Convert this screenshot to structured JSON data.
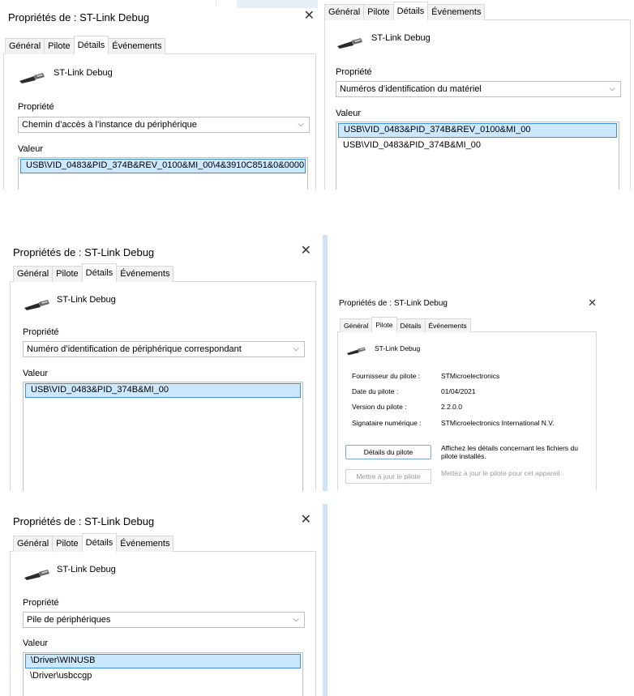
{
  "title": "Propriétés de : ST-Link Debug",
  "close_glyph": "✕",
  "chevron_glyph": "⌵",
  "tabs": [
    "Général",
    "Pilote",
    "Détails",
    "Événements"
  ],
  "device_name": "ST-Link Debug",
  "property_label": "Propriété",
  "value_label": "Valeur",
  "panel1": {
    "property": "Chemin d’accès à l’instance du périphérique",
    "values": [
      "USB\\VID_0483&PID_374B&REV_0100&MI_00\\4&3910C851&0&0000"
    ]
  },
  "panel2": {
    "property": "Numéros d’identification du matériel",
    "values": [
      "USB\\VID_0483&PID_374B&REV_0100&MI_00",
      "USB\\VID_0483&PID_374B&MI_00"
    ]
  },
  "panel3": {
    "property": "Numéro d’identification de périphérique correspondant",
    "values": [
      "USB\\VID_0483&PID_374B&MI_00"
    ]
  },
  "panel4": {
    "fields": [
      {
        "key": "Fournisseur du pilote :",
        "value": "STMicroelectronics"
      },
      {
        "key": "Date du pilote :",
        "value": "01/04/2021"
      },
      {
        "key": "Version du pilote :",
        "value": "2.2.0.0"
      },
      {
        "key": "Signataire numérique :",
        "value": "STMicroelectronics International N.V."
      }
    ],
    "details_button": "Détails du pilote",
    "details_desc": "Affichez les détails concernant les fichiers du pilote installés.",
    "update_button": "Mettre à jour le pilote",
    "update_desc": "Mettez à jour le pilote pour cet appareil."
  },
  "panel5": {
    "property": "Pile de périphériques",
    "values": [
      "\\Driver\\WINUSB",
      "\\Driver\\usbccgp"
    ]
  }
}
